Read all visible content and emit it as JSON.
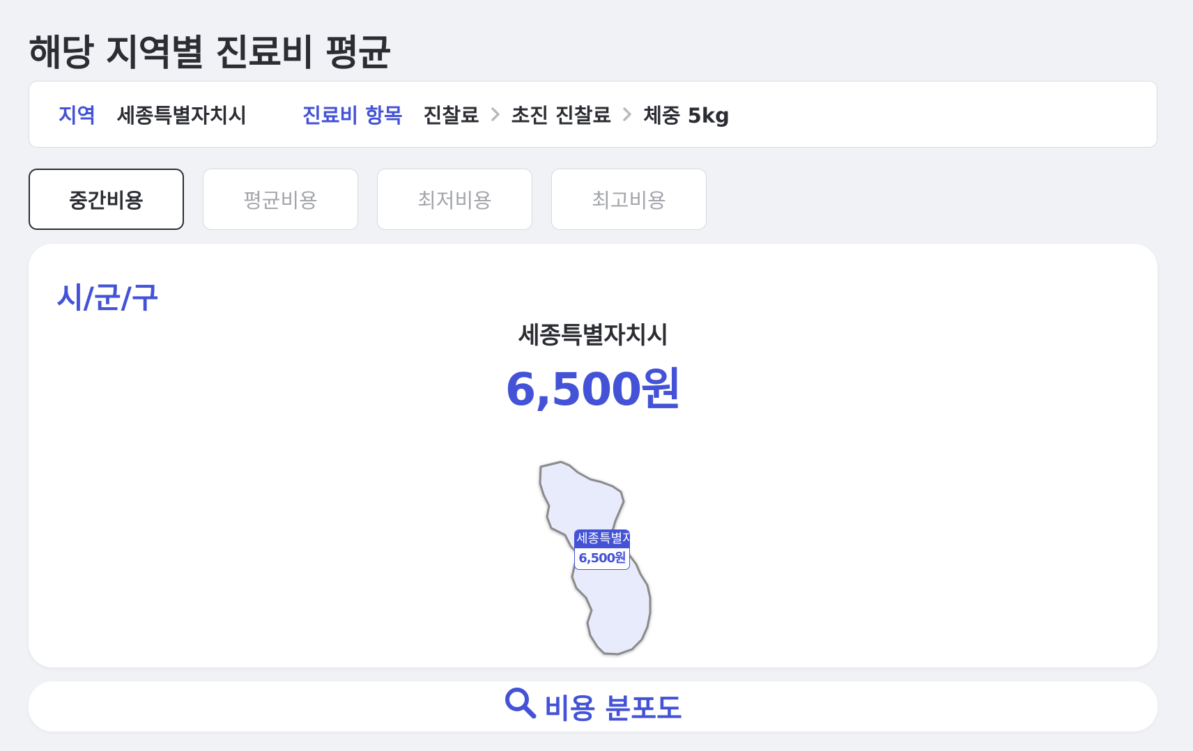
{
  "page": {
    "title": "해당 지역별 진료비 평균"
  },
  "filters": {
    "region_label": "지역",
    "region_value": "세종특별자치시",
    "item_label": "진료비 항목",
    "item_path": [
      "진찰료",
      "초진 진찰료",
      "체중 5kg"
    ]
  },
  "tabs": [
    {
      "label": "중간비용",
      "active": true
    },
    {
      "label": "평균비용",
      "active": false
    },
    {
      "label": "최저비용",
      "active": false
    },
    {
      "label": "최고비용",
      "active": false
    }
  ],
  "map_card": {
    "heading": "시/군/구",
    "region_name": "세종특별자치시",
    "price": "6,500원",
    "map_label": {
      "name": "세종특별자치시",
      "value": "6,500원"
    }
  },
  "distribution_button": {
    "label": "비용 분포도",
    "icon": "search-icon"
  },
  "colors": {
    "accent": "#4352d6",
    "region_fill": "#e8ebfb",
    "region_stroke": "#8a8a8a",
    "background": "#f1f2f6"
  }
}
